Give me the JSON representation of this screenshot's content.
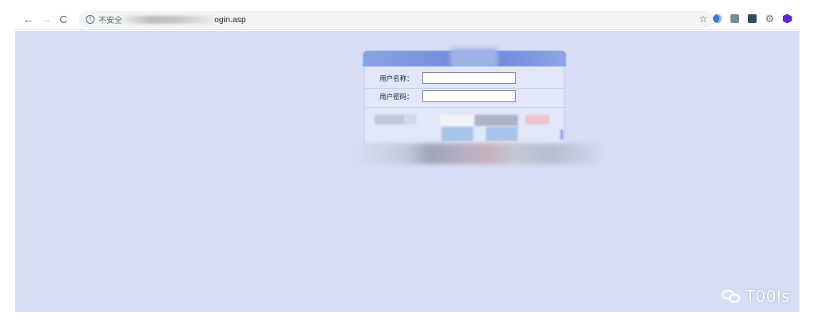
{
  "browser": {
    "back_icon": "←",
    "forward_icon": "→",
    "reload_icon": "C",
    "info_icon": "!",
    "security_text": "不安全",
    "url_suffix": "ogin.asp",
    "bookmark_icon": "☆",
    "extension_icons": [
      "blue-circle-icon",
      "gray-square-icon",
      "dark-square-icon",
      "gear-icon",
      "purple-hex-icon"
    ]
  },
  "login": {
    "username_label": "用户名称：",
    "password_label": "用户密码：",
    "username_value": "",
    "password_value": ""
  },
  "watermark": {
    "text": "T00ls"
  },
  "colors": {
    "page_background": "#d6ddf5",
    "header_blue": "#6a86d8",
    "panel_background": "#e1e7f8"
  }
}
